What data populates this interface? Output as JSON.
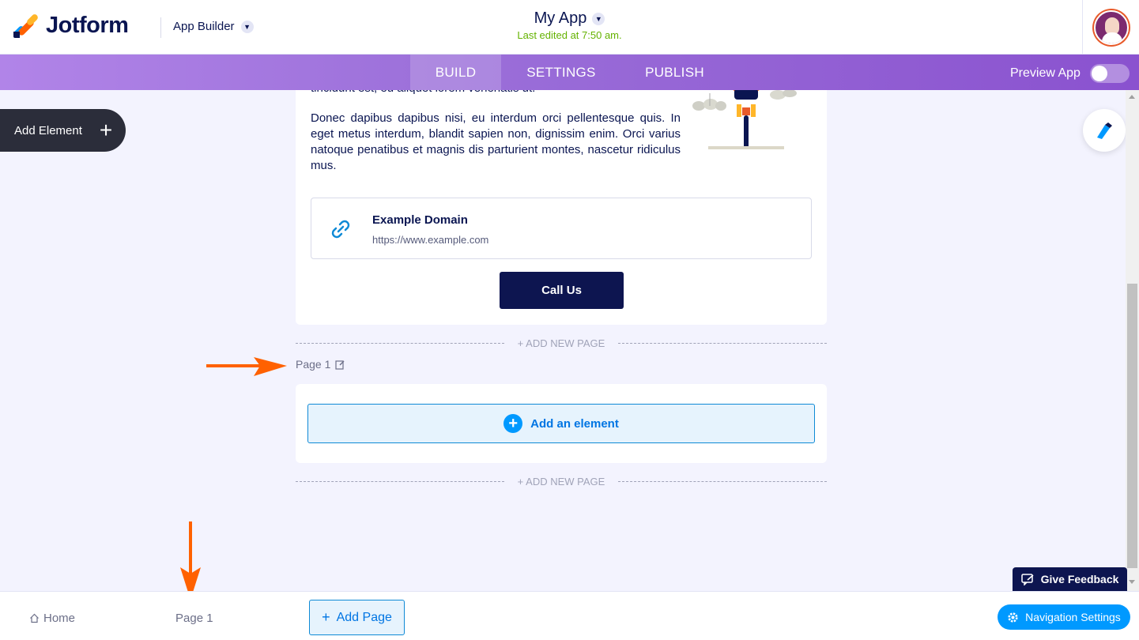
{
  "header": {
    "brand": "Jotform",
    "section": "App Builder",
    "app_name": "My App",
    "last_edited": "Last edited at 7:50 am."
  },
  "nav": {
    "tabs": [
      {
        "label": "BUILD",
        "active": true
      },
      {
        "label": "SETTINGS",
        "active": false
      },
      {
        "label": "PUBLISH",
        "active": false
      }
    ],
    "preview_label": "Preview App"
  },
  "sidebar": {
    "add_element_label": "Add Element"
  },
  "canvas": {
    "cut_text": "tincidunt est, eu aliquet lorem venenatis ut.",
    "paragraph": "Donec dapibus dapibus nisi, eu interdum orci pellentesque quis. In eget metus interdum, blandit sapien non, dignissim enim. Orci varius natoque penatibus et magnis dis parturient montes, nascetur ridiculus mus.",
    "link": {
      "title": "Example Domain",
      "url": "https://www.example.com"
    },
    "call_button": "Call Us",
    "add_new_page": "+ ADD NEW PAGE",
    "page_label": "Page 1",
    "add_an_element": "Add an element"
  },
  "bottom": {
    "home": "Home",
    "page1": "Page 1",
    "add_page": "Add Page",
    "nav_settings": "Navigation Settings",
    "feedback": "Give Feedback"
  },
  "colors": {
    "brand_navy": "#0a1551",
    "accent_blue": "#0099ff",
    "purple": "#9b6fd9",
    "annotation_orange": "#ff6100"
  }
}
